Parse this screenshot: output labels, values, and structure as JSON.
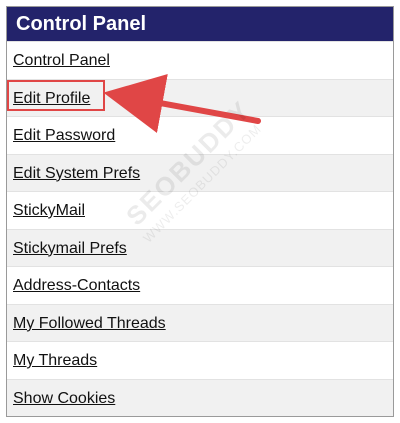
{
  "panel": {
    "title": "Control Panel",
    "items": [
      {
        "label": "Control Panel"
      },
      {
        "label": "Edit Profile"
      },
      {
        "label": "Edit Password"
      },
      {
        "label": "Edit System Prefs"
      },
      {
        "label": "StickyMail"
      },
      {
        "label": "Stickymail Prefs"
      },
      {
        "label": "Address-Contacts"
      },
      {
        "label": "My Followed Threads"
      },
      {
        "label": "My Threads"
      },
      {
        "label": "Show Cookies"
      }
    ]
  },
  "annotation": {
    "highlight_color": "#e04646",
    "target": "Edit Profile"
  },
  "watermark": {
    "logo_text": "SEOBUDDY",
    "url_text": "WWW.SEOBUDDY.COM"
  },
  "colors": {
    "header_bg": "#23236b",
    "alt_row_bg": "#f1f1f1"
  }
}
